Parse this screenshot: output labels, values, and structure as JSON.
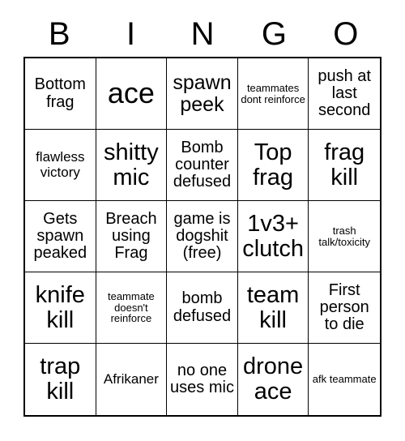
{
  "card": {
    "header_letters": [
      "B",
      "I",
      "N",
      "G",
      "O"
    ],
    "rows": [
      [
        {
          "text": "Bottom frag",
          "size": "md"
        },
        {
          "text": "ace",
          "size": "xxl"
        },
        {
          "text": "spawn peek",
          "size": "lg"
        },
        {
          "text": "teammates dont reinforce",
          "size": "xs"
        },
        {
          "text": "push at last second",
          "size": "md"
        }
      ],
      [
        {
          "text": "flawless victory",
          "size": "sm"
        },
        {
          "text": "shitty mic",
          "size": "xl"
        },
        {
          "text": "Bomb counter defused",
          "size": "md"
        },
        {
          "text": "Top frag",
          "size": "xl"
        },
        {
          "text": "frag kill",
          "size": "xl"
        }
      ],
      [
        {
          "text": "Gets spawn peaked",
          "size": "md"
        },
        {
          "text": "Breach using Frag",
          "size": "md"
        },
        {
          "text": "game is dogshit (free)",
          "size": "md"
        },
        {
          "text": "1v3+ clutch",
          "size": "xl"
        },
        {
          "text": "trash talk/toxicity",
          "size": "xs"
        }
      ],
      [
        {
          "text": "knife kill",
          "size": "xl"
        },
        {
          "text": "teammate doesn't reinforce",
          "size": "xs"
        },
        {
          "text": "bomb defused",
          "size": "md"
        },
        {
          "text": "team kill",
          "size": "xl"
        },
        {
          "text": "First person to die",
          "size": "md"
        }
      ],
      [
        {
          "text": "trap kill",
          "size": "xl"
        },
        {
          "text": "Afrikaner",
          "size": "sm"
        },
        {
          "text": "no one uses mic",
          "size": "md"
        },
        {
          "text": "drone ace",
          "size": "xl"
        },
        {
          "text": "afk teammate",
          "size": "xs"
        }
      ]
    ]
  },
  "colors": {
    "background": "#ffffff",
    "border": "#000000",
    "text": "#000000"
  }
}
